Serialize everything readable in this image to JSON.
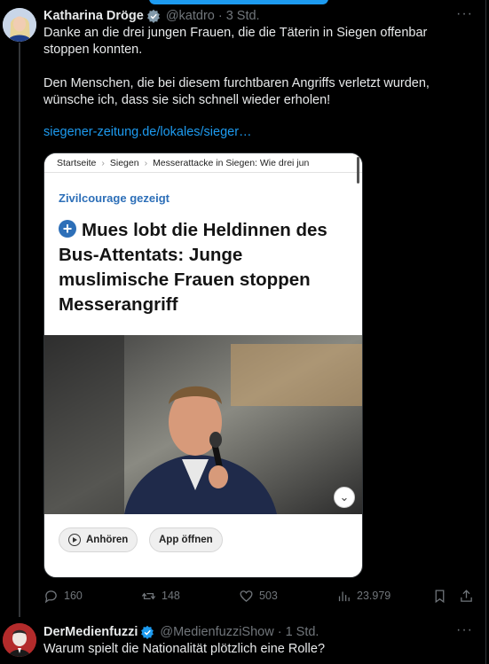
{
  "tweet1": {
    "display_name": "Katharina Dröge",
    "handle": "@katdro",
    "separator": "·",
    "time": "3 Std.",
    "more_label": "···",
    "paragraph1": "Danke an die drei jungen Frauen, die die Täterin in Siegen offenbar stoppen konnten.",
    "paragraph2": "Den Menschen, die bei diesem furchtbaren Angriffs verletzt wurden, wünsche ich, dass sie sich schnell wieder erholen!",
    "link": "siegener-zeitung.de/lokales/sieger…",
    "card": {
      "breadcrumb": [
        "Startseite",
        "Siegen",
        "Messerattacke in Siegen: Wie drei jun"
      ],
      "breadcrumb_sep": "›",
      "kicker": "Zivilcourage gezeigt",
      "plus_symbol": "+",
      "headline": "Mues lobt die Heldinnen des Bus-Attentats: Junge muslimische Frauen stoppen Messerangriff",
      "chevron": "⌄",
      "listen_label": "Anhören",
      "app_label": "App öffnen"
    },
    "actions": {
      "replies": "160",
      "reposts": "148",
      "likes": "503",
      "views": "23.979"
    }
  },
  "tweet2": {
    "display_name": "DerMedienfuzzi",
    "handle": "@MedienfuzziShow",
    "separator": "·",
    "time": "1 Std.",
    "more_label": "···",
    "text": "Warum spielt die Nationalität plötzlich eine Rolle?"
  },
  "colors": {
    "background": "#000000",
    "text": "#e7e9ea",
    "muted": "#71767b",
    "link": "#1d9bf0",
    "verified": "#1d9bf0",
    "kicker": "#2d6fb8"
  },
  "icons": [
    "verified-badge-icon",
    "reply-icon",
    "repost-icon",
    "like-icon",
    "views-icon",
    "bookmark-icon",
    "share-icon",
    "play-icon",
    "chevron-down-icon",
    "plus-icon"
  ]
}
